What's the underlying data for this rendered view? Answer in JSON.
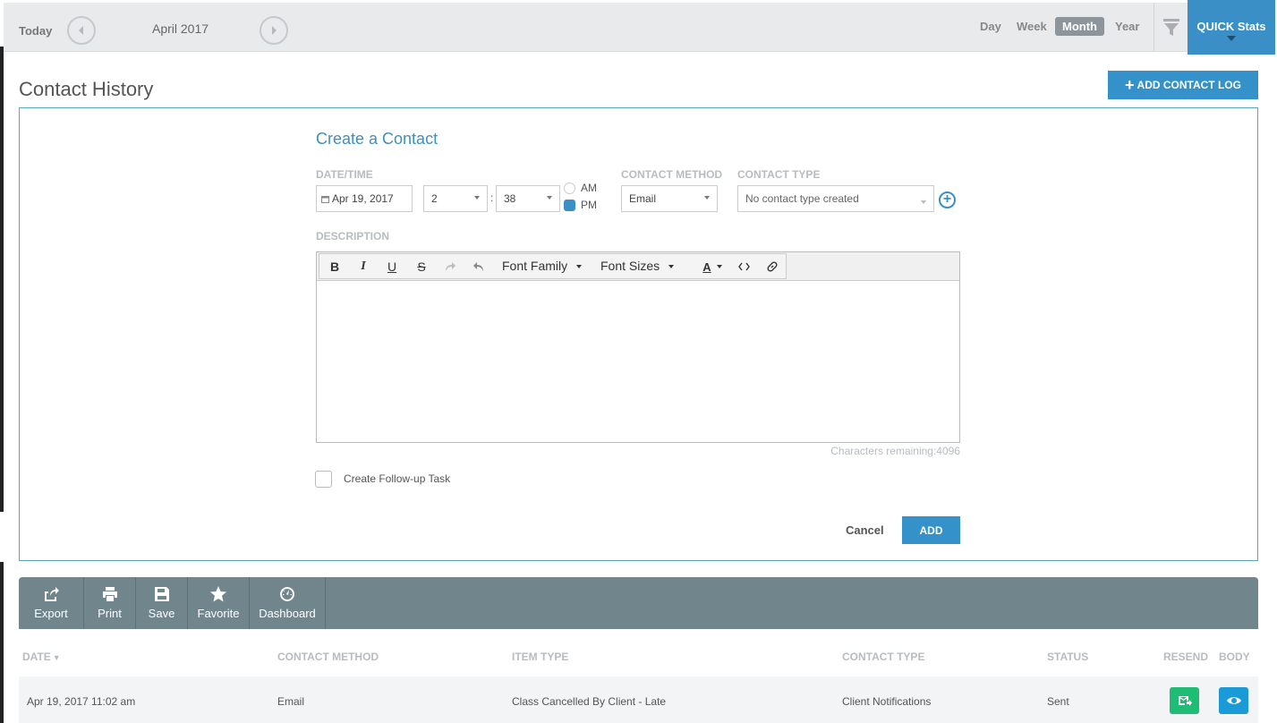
{
  "topbar": {
    "today": "Today",
    "month_label": "April 2017",
    "views": [
      "Day",
      "Week",
      "Month",
      "Year"
    ],
    "active_view": "Month",
    "quick_stats": "QUICK Stats"
  },
  "page": {
    "title": "Contact History",
    "add_contact_log": "ADD CONTACT LOG"
  },
  "form": {
    "title": "Create a Contact",
    "datetime_label": "DATE/TIME",
    "date": "Apr 19, 2017",
    "hour": "2",
    "minute": "38",
    "am": "AM",
    "pm": "PM",
    "selected_meridiem": "PM",
    "method_label": "CONTACT METHOD",
    "method": "Email",
    "type_label": "CONTACT TYPE",
    "type": "No contact type created",
    "description_label": "DESCRIPTION",
    "editor": {
      "bold": "B",
      "italic": "I",
      "underline": "U",
      "strike": "S",
      "font_family": "Font Family",
      "font_sizes": "Font Sizes",
      "text_color": "A"
    },
    "chars_remaining": "Characters remaining:4096",
    "followup_label": "Create Follow-up Task",
    "cancel": "Cancel",
    "add": "ADD"
  },
  "actions": {
    "export": "Export",
    "print": "Print",
    "save": "Save",
    "favorite": "Favorite",
    "dashboard": "Dashboard"
  },
  "table": {
    "headers": {
      "date": "DATE",
      "method": "CONTACT METHOD",
      "item_type": "ITEM TYPE",
      "contact_type": "CONTACT TYPE",
      "status": "STATUS",
      "resend": "RESEND",
      "body": "BODY"
    },
    "rows": [
      {
        "date": "Apr 19, 2017 11:02 am",
        "method": "Email",
        "item_type": "Class Cancelled By Client - Late",
        "contact_type": "Client Notifications",
        "status": "Sent"
      }
    ]
  },
  "colors": {
    "accent": "#3591c9",
    "toolbar": "#71858d",
    "resend": "#1fbc76",
    "body": "#1a9ad6"
  }
}
